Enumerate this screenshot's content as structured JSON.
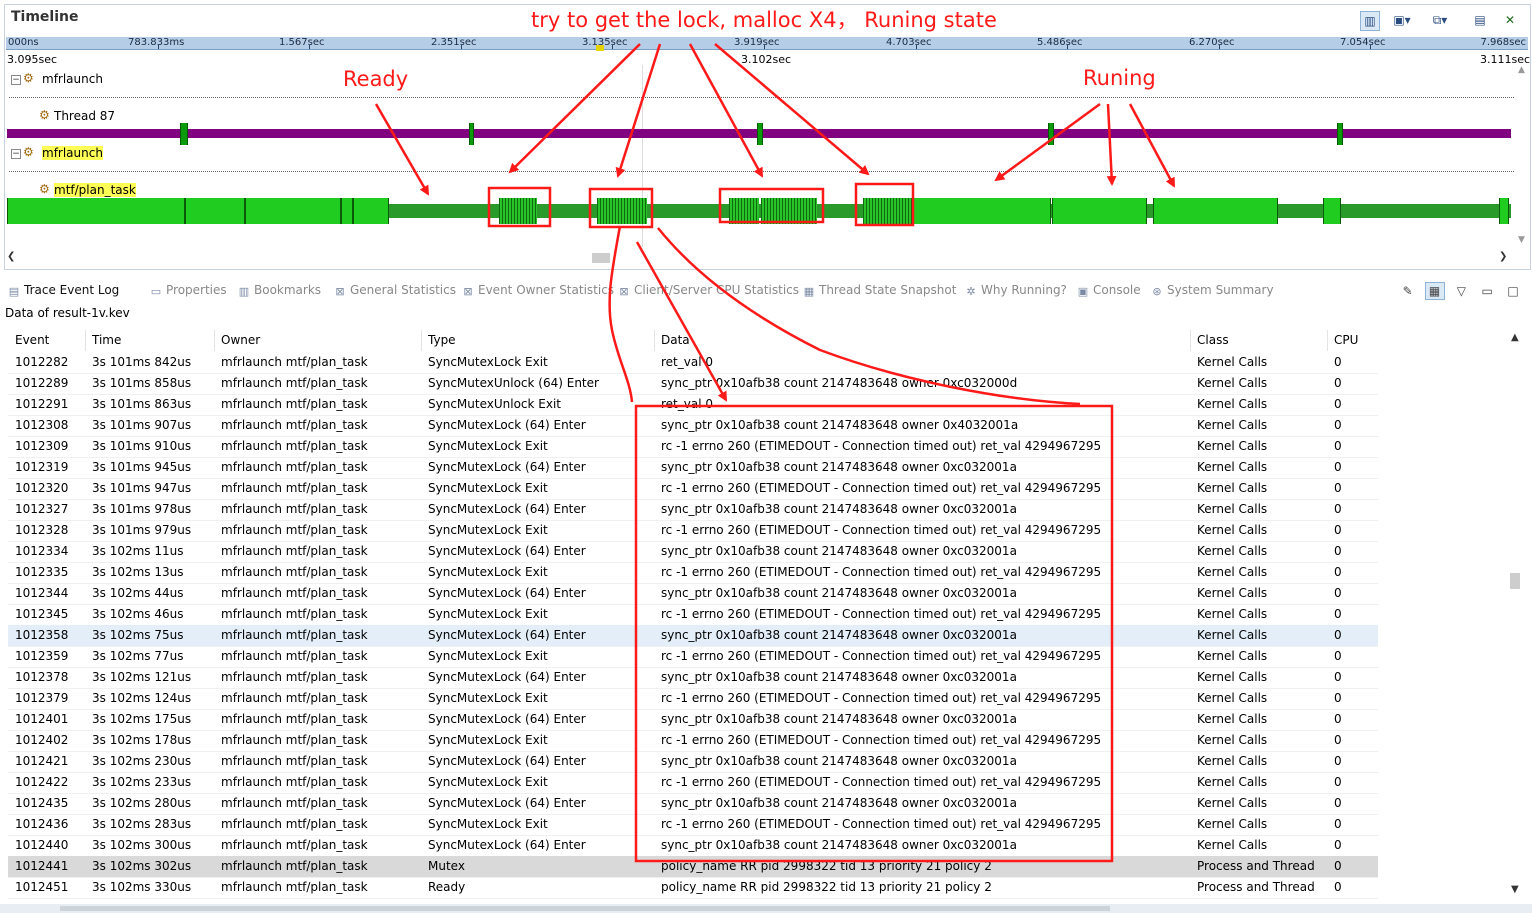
{
  "timeline": {
    "title": "Timeline",
    "ruler_labels": [
      "000ns",
      "783.833ms",
      "1.567sec",
      "2.351sec",
      "3.135sec",
      "3.919sec",
      "4.703sec",
      "5.486sec",
      "6.270sec",
      "7.054sec",
      "7.968sec"
    ],
    "range_left": "3.095sec",
    "range_mid": "3.102sec",
    "range_right": "3.111sec",
    "tree": {
      "proc1": "mfrlaunch",
      "thread1": "Thread 87",
      "proc2": "mfrlaunch",
      "thread2": "mtf/plan_task"
    },
    "colors": {
      "running": "#1fcc1f",
      "ready": "#2a9a2a",
      "thread_bar": "#800080",
      "annotation": "#ff1a1a"
    }
  },
  "annotations": {
    "top": "try to get the lock, malloc X4，  Runing state",
    "ready": "Ready",
    "running": "Runing"
  },
  "tabs": [
    {
      "label": "Trace Event Log",
      "icon": "trace-log-icon",
      "active": true
    },
    {
      "label": "Properties",
      "icon": "properties-icon"
    },
    {
      "label": "Bookmarks",
      "icon": "bookmarks-icon"
    },
    {
      "label": "General Statistics",
      "icon": "statistics-icon"
    },
    {
      "label": "Event Owner Statistics",
      "icon": "statistics-icon"
    },
    {
      "label": "Client/Server CPU Statistics",
      "icon": "statistics-icon"
    },
    {
      "label": "Thread State Snapshot",
      "icon": "snapshot-icon"
    },
    {
      "label": "Why Running?",
      "icon": "why-running-icon"
    },
    {
      "label": "Console",
      "icon": "console-icon"
    },
    {
      "label": "System Summary",
      "icon": "summary-icon"
    }
  ],
  "data_of": "Data of result-1v.kev",
  "table": {
    "columns": [
      "Event",
      "Time",
      "Owner",
      "Type",
      "Data",
      "Class",
      "CPU"
    ],
    "rows": [
      [
        "1012282",
        "3s 101ms 842us",
        "mfrlaunch mtf/plan_task",
        "SyncMutexLock Exit",
        "ret_val 0",
        "Kernel Calls",
        "0"
      ],
      [
        "1012289",
        "3s 101ms 858us",
        "mfrlaunch mtf/plan_task",
        "SyncMutexUnlock (64) Enter",
        "sync_ptr 0x10afb38 count 2147483648 owner 0xc032000d",
        "Kernel Calls",
        "0"
      ],
      [
        "1012291",
        "3s 101ms 863us",
        "mfrlaunch mtf/plan_task",
        "SyncMutexUnlock Exit",
        "ret_val 0",
        "Kernel Calls",
        "0"
      ],
      [
        "1012308",
        "3s 101ms 907us",
        "mfrlaunch mtf/plan_task",
        "SyncMutexLock (64) Enter",
        "sync_ptr 0x10afb38 count 2147483648 owner 0x4032001a",
        "Kernel Calls",
        "0"
      ],
      [
        "1012309",
        "3s 101ms 910us",
        "mfrlaunch mtf/plan_task",
        "SyncMutexLock Exit",
        "rc -1 errno 260 (ETIMEDOUT - Connection timed out) ret_val 4294967295",
        "Kernel Calls",
        "0"
      ],
      [
        "1012319",
        "3s 101ms 945us",
        "mfrlaunch mtf/plan_task",
        "SyncMutexLock (64) Enter",
        "sync_ptr 0x10afb38 count 2147483648 owner 0xc032001a",
        "Kernel Calls",
        "0"
      ],
      [
        "1012320",
        "3s 101ms 947us",
        "mfrlaunch mtf/plan_task",
        "SyncMutexLock Exit",
        "rc -1 errno 260 (ETIMEDOUT - Connection timed out) ret_val 4294967295",
        "Kernel Calls",
        "0"
      ],
      [
        "1012327",
        "3s 101ms 978us",
        "mfrlaunch mtf/plan_task",
        "SyncMutexLock (64) Enter",
        "sync_ptr 0x10afb38 count 2147483648 owner 0xc032001a",
        "Kernel Calls",
        "0"
      ],
      [
        "1012328",
        "3s 101ms 979us",
        "mfrlaunch mtf/plan_task",
        "SyncMutexLock Exit",
        "rc -1 errno 260 (ETIMEDOUT - Connection timed out) ret_val 4294967295",
        "Kernel Calls",
        "0"
      ],
      [
        "1012334",
        "3s 102ms 11us",
        "mfrlaunch mtf/plan_task",
        "SyncMutexLock (64) Enter",
        "sync_ptr 0x10afb38 count 2147483648 owner 0xc032001a",
        "Kernel Calls",
        "0"
      ],
      [
        "1012335",
        "3s 102ms 13us",
        "mfrlaunch mtf/plan_task",
        "SyncMutexLock Exit",
        "rc -1 errno 260 (ETIMEDOUT - Connection timed out) ret_val 4294967295",
        "Kernel Calls",
        "0"
      ],
      [
        "1012344",
        "3s 102ms 44us",
        "mfrlaunch mtf/plan_task",
        "SyncMutexLock (64) Enter",
        "sync_ptr 0x10afb38 count 2147483648 owner 0xc032001a",
        "Kernel Calls",
        "0"
      ],
      [
        "1012345",
        "3s 102ms 46us",
        "mfrlaunch mtf/plan_task",
        "SyncMutexLock Exit",
        "rc -1 errno 260 (ETIMEDOUT - Connection timed out) ret_val 4294967295",
        "Kernel Calls",
        "0"
      ],
      [
        "1012358",
        "3s 102ms 75us",
        "mfrlaunch mtf/plan_task",
        "SyncMutexLock (64) Enter",
        "sync_ptr 0x10afb38 count 2147483648 owner 0xc032001a",
        "Kernel Calls",
        "0"
      ],
      [
        "1012359",
        "3s 102ms 77us",
        "mfrlaunch mtf/plan_task",
        "SyncMutexLock Exit",
        "rc -1 errno 260 (ETIMEDOUT - Connection timed out) ret_val 4294967295",
        "Kernel Calls",
        "0"
      ],
      [
        "1012378",
        "3s 102ms 121us",
        "mfrlaunch mtf/plan_task",
        "SyncMutexLock (64) Enter",
        "sync_ptr 0x10afb38 count 2147483648 owner 0xc032001a",
        "Kernel Calls",
        "0"
      ],
      [
        "1012379",
        "3s 102ms 124us",
        "mfrlaunch mtf/plan_task",
        "SyncMutexLock Exit",
        "rc -1 errno 260 (ETIMEDOUT - Connection timed out) ret_val 4294967295",
        "Kernel Calls",
        "0"
      ],
      [
        "1012401",
        "3s 102ms 175us",
        "mfrlaunch mtf/plan_task",
        "SyncMutexLock (64) Enter",
        "sync_ptr 0x10afb38 count 2147483648 owner 0xc032001a",
        "Kernel Calls",
        "0"
      ],
      [
        "1012402",
        "3s 102ms 178us",
        "mfrlaunch mtf/plan_task",
        "SyncMutexLock Exit",
        "rc -1 errno 260 (ETIMEDOUT - Connection timed out) ret_val 4294967295",
        "Kernel Calls",
        "0"
      ],
      [
        "1012421",
        "3s 102ms 230us",
        "mfrlaunch mtf/plan_task",
        "SyncMutexLock (64) Enter",
        "sync_ptr 0x10afb38 count 2147483648 owner 0xc032001a",
        "Kernel Calls",
        "0"
      ],
      [
        "1012422",
        "3s 102ms 233us",
        "mfrlaunch mtf/plan_task",
        "SyncMutexLock Exit",
        "rc -1 errno 260 (ETIMEDOUT - Connection timed out) ret_val 4294967295",
        "Kernel Calls",
        "0"
      ],
      [
        "1012435",
        "3s 102ms 280us",
        "mfrlaunch mtf/plan_task",
        "SyncMutexLock (64) Enter",
        "sync_ptr 0x10afb38 count 2147483648 owner 0xc032001a",
        "Kernel Calls",
        "0"
      ],
      [
        "1012436",
        "3s 102ms 283us",
        "mfrlaunch mtf/plan_task",
        "SyncMutexLock Exit",
        "rc -1 errno 260 (ETIMEDOUT - Connection timed out) ret_val 4294967295",
        "Kernel Calls",
        "0"
      ],
      [
        "1012440",
        "3s 102ms 300us",
        "mfrlaunch mtf/plan_task",
        "SyncMutexLock (64) Enter",
        "sync_ptr 0x10afb38 count 2147483648 owner 0xc032001a",
        "Kernel Calls",
        "0"
      ],
      [
        "1012441",
        "3s 102ms 302us",
        "mfrlaunch mtf/plan_task",
        "Mutex",
        "policy_name RR pid 2998322 tid 13 priority 21 policy 2",
        "Process and Thread",
        "0"
      ],
      [
        "1012451",
        "3s 102ms 330us",
        "mfrlaunch mtf/plan_task",
        "Ready",
        "policy_name RR pid 2998322 tid 13 priority 21 policy 2",
        "Process and Thread",
        "0"
      ]
    ],
    "selected_rows": {
      "blue": 13,
      "gray": 24
    }
  }
}
